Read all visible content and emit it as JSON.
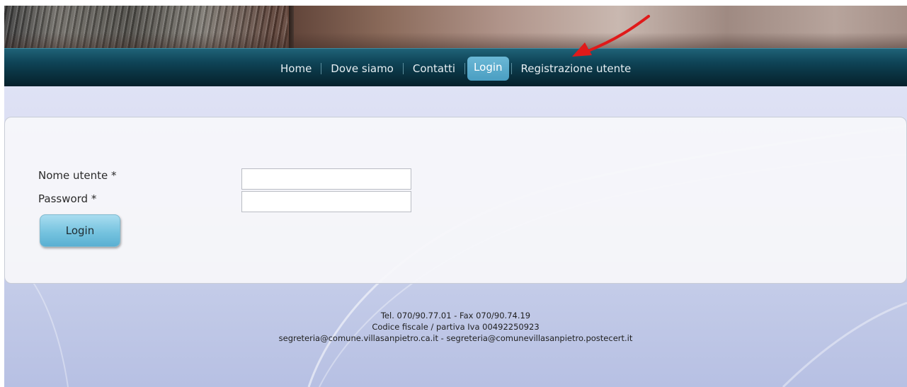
{
  "nav": {
    "items": [
      {
        "label": "Home"
      },
      {
        "label": "Dove siamo"
      },
      {
        "label": "Contatti"
      },
      {
        "label": "Login"
      },
      {
        "label": "Registrazione utente"
      }
    ],
    "active": "Login"
  },
  "login_form": {
    "username_label": "Nome utente *",
    "username_value": "",
    "password_label": "Password *",
    "password_value": "",
    "submit_label": "Login"
  },
  "footer": {
    "line1": "Tel. 070/90.77.01 - Fax 070/90.74.19",
    "line2": "Codice fiscale / partiva Iva 00492250923",
    "line3": "segreteria@comune.villasanpietro.ca.it - segreteria@comunevillasanpietro.postecert.it"
  },
  "colors": {
    "nav_bg": "#0a3342",
    "nav_active": "#5aaed0",
    "annotation_arrow": "#e01a1a"
  },
  "icons": {
    "annotation": "red-arrow-icon"
  }
}
